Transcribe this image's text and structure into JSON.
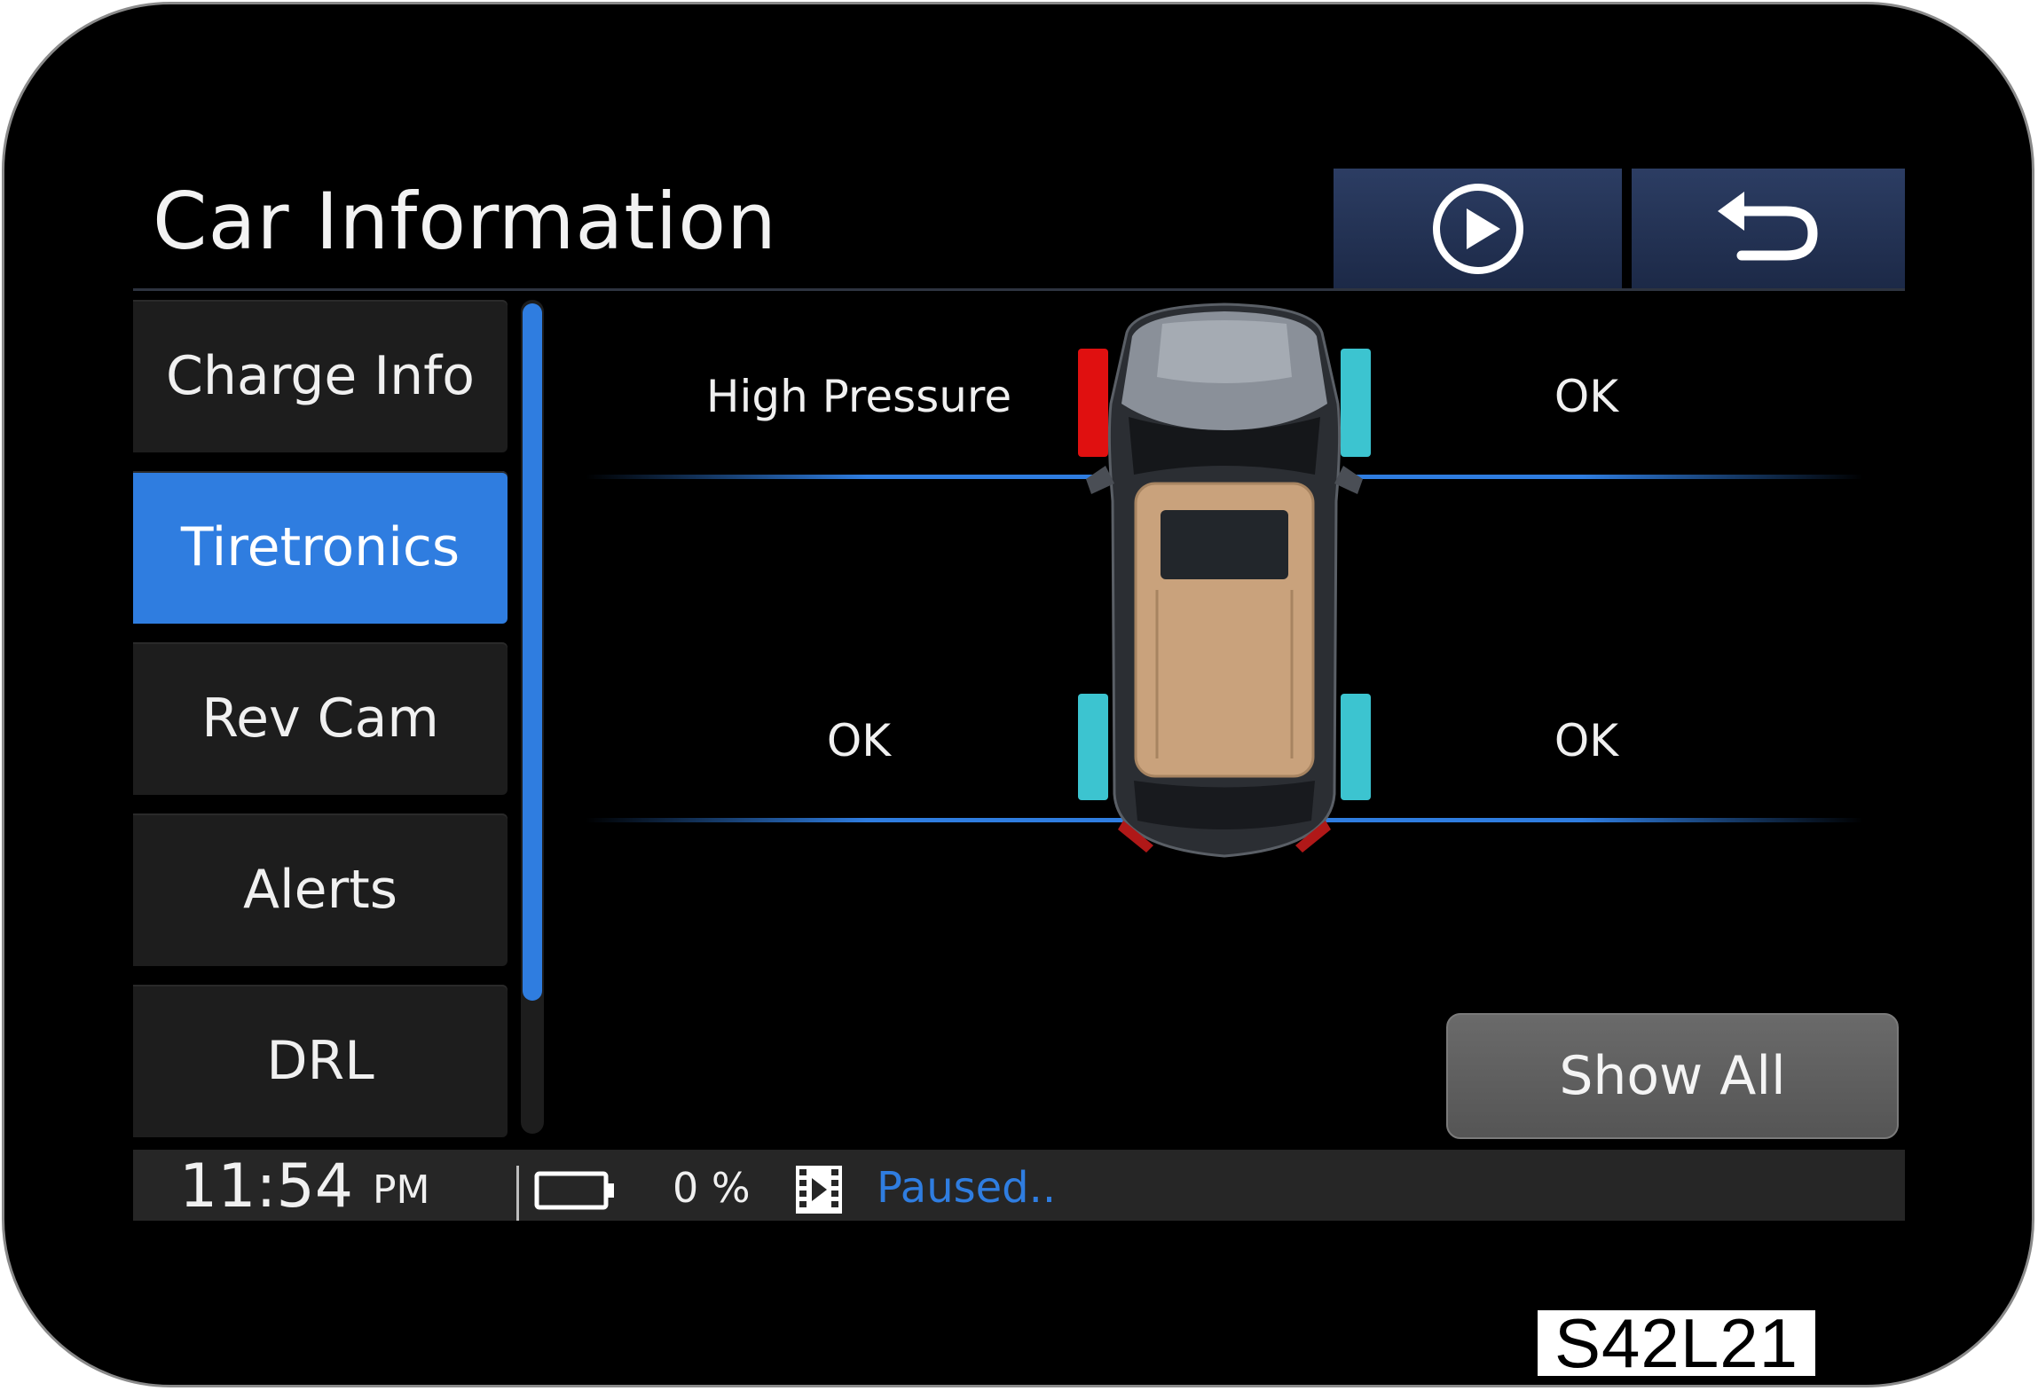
{
  "header": {
    "title": "Car Information",
    "play_icon": "play-circle-icon",
    "back_icon": "back-arrow-icon"
  },
  "sidebar": {
    "items": [
      {
        "label": "Charge Info",
        "active": false
      },
      {
        "label": "Tiretronics",
        "active": true
      },
      {
        "label": "Rev Cam",
        "active": false
      },
      {
        "label": "Alerts",
        "active": false
      },
      {
        "label": "DRL",
        "active": false
      }
    ]
  },
  "tires": {
    "front_left": {
      "status": "High Pressure",
      "color": "#e01010"
    },
    "front_right": {
      "status": "OK",
      "color": "#3cc4d0"
    },
    "rear_left": {
      "status": "OK",
      "color": "#3cc4d0"
    },
    "rear_right": {
      "status": "OK",
      "color": "#3cc4d0"
    }
  },
  "show_all_label": "Show All",
  "status_bar": {
    "time": "11:54",
    "ampm": "PM",
    "battery_percent": "0 %",
    "battery_icon": "battery-icon",
    "media_icon": "media-file-icon",
    "media_status": "Paused.."
  },
  "figure_code": "S42L21",
  "colors": {
    "accent": "#2f7de0",
    "header_button": "#24335a",
    "warning": "#e01010",
    "ok": "#3cc4d0"
  }
}
